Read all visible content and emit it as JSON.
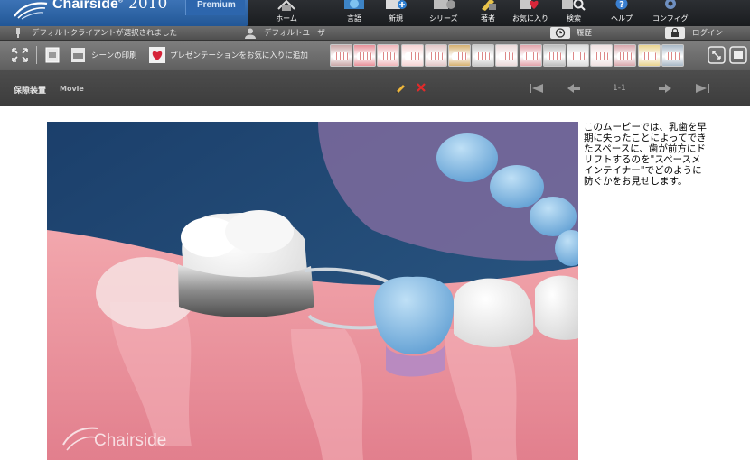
{
  "app": {
    "name": "Chairside",
    "year": "2010",
    "edition": "Premium"
  },
  "nav": [
    {
      "key": "home",
      "label": "ホーム",
      "icon": "house-icon"
    },
    {
      "key": "language",
      "label": "言語",
      "icon": "globe-book-icon"
    },
    {
      "key": "new",
      "label": "新規",
      "icon": "new-document-icon"
    },
    {
      "key": "series",
      "label": "シリーズ",
      "icon": "film-reel-icon"
    },
    {
      "key": "author",
      "label": "著者",
      "icon": "author-icon"
    },
    {
      "key": "favorites",
      "label": "お気に入り",
      "icon": "heart-icon"
    },
    {
      "key": "search",
      "label": "検索",
      "icon": "magnifier-icon"
    },
    {
      "key": "help",
      "label": "ヘルプ",
      "icon": "help-icon"
    },
    {
      "key": "config",
      "label": "コンフィグ",
      "icon": "gear-icon"
    }
  ],
  "status": {
    "client": "デフォルトクライアントが選択されました",
    "user": "デフォルトユーザー",
    "history": "履歴",
    "login": "ログイン"
  },
  "toolbar": {
    "print_label": "シーンの印刷",
    "favorite_label": "プレゼンテーションをお気に入りに追加",
    "thumbnails": [
      "brush-thumb",
      "lower-jaw-thumb",
      "teeth-arch-thumb",
      "upper-teeth-thumb",
      "smile-thumb",
      "roots-thumb",
      "braces-thumb",
      "molar-thumb",
      "gums-thumb",
      "implant-thumb",
      "canine-thumb",
      "crown-thumb",
      "bridge-thumb",
      "floss-thumb",
      "xray-thumb"
    ]
  },
  "movie_header": {
    "title": "保隙装置",
    "type": "Movie",
    "page": "1-1"
  },
  "movie": {
    "watermark": "Chairside"
  },
  "description": "このムービーでは、乳歯を早期に失ったことによってできたスペースに、歯が前方にドリフトするのを\"スペースメインテイナー\"でどのように 防ぐかをお見せします。"
}
